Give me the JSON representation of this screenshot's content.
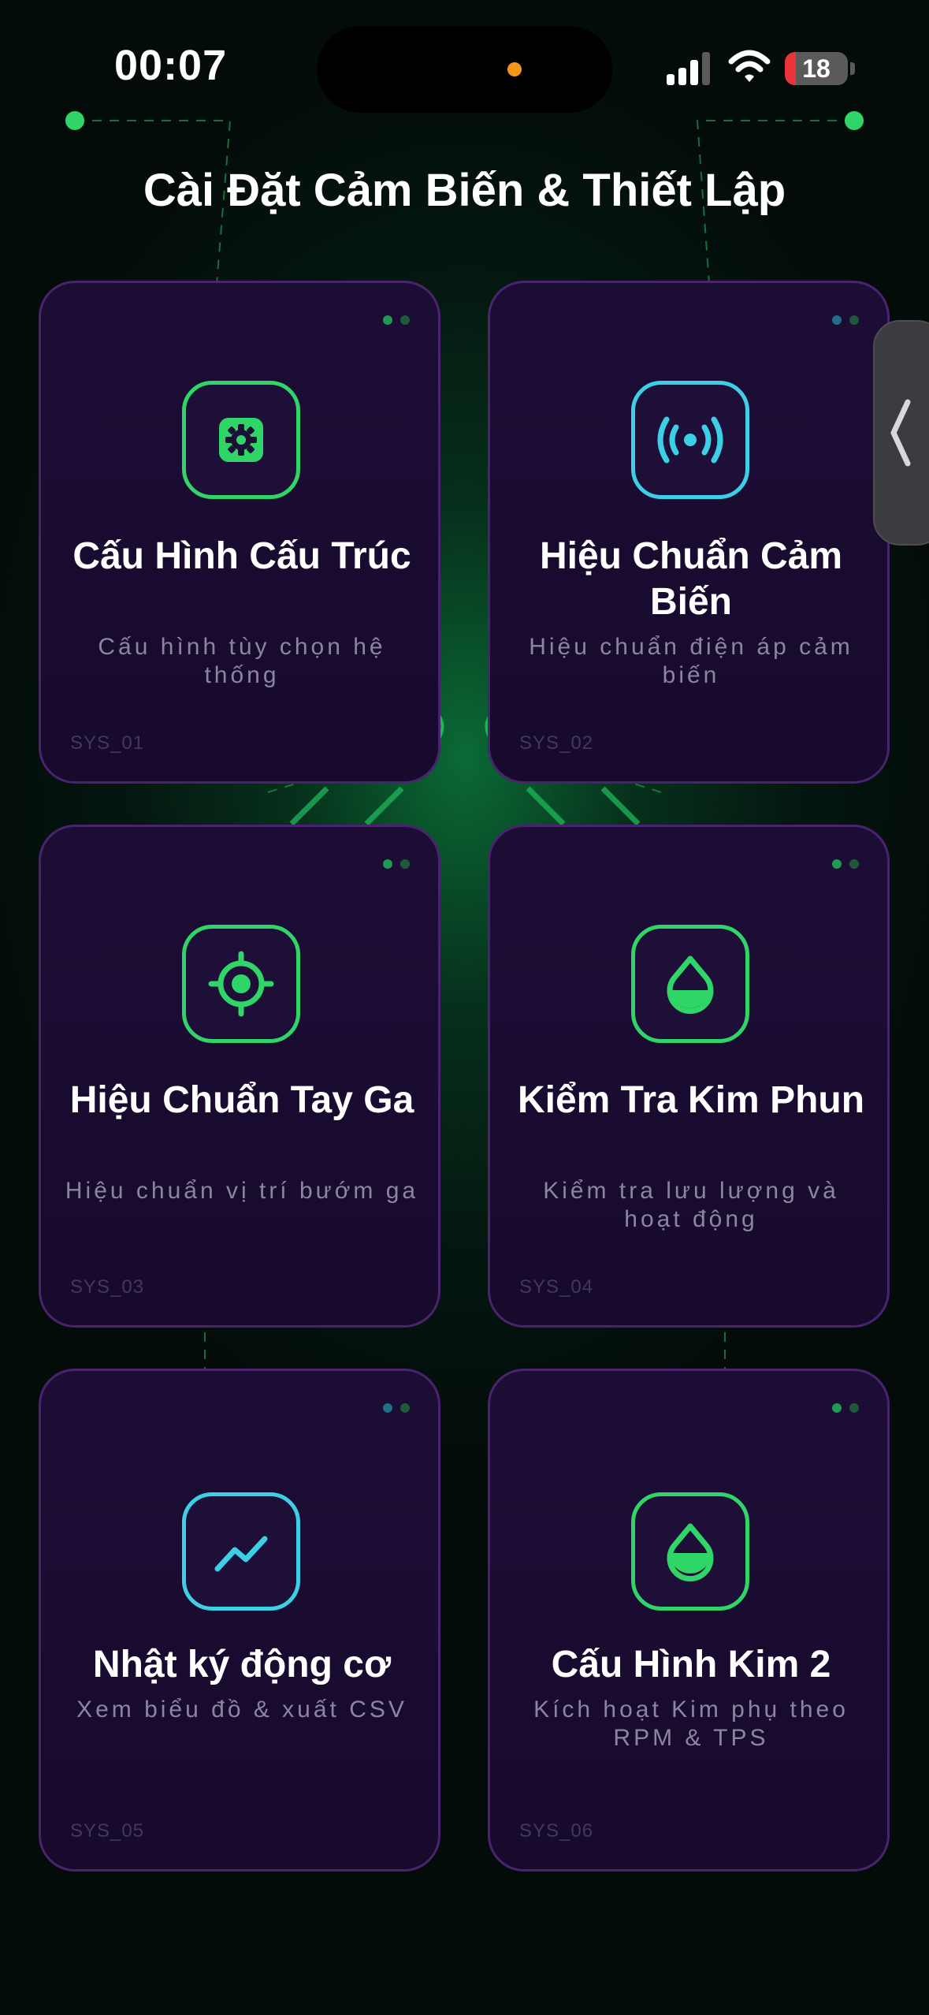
{
  "status_bar": {
    "time": "00:07",
    "battery_level": "18",
    "battery_fraction": 0.18,
    "signal_bars": 3
  },
  "page": {
    "title": "Cài Đặt Cảm Biến & Thiết Lập"
  },
  "colors": {
    "accent_green": "#2fd567",
    "accent_cyan": "#3ccfe6",
    "card_border": "#4a2370",
    "card_bg": "#1c0d35"
  },
  "cards": [
    {
      "title": "Cấu Hình Cấu Trúc",
      "subtitle": "Cấu hình tùy chọn hệ thống",
      "code": "SYS_01",
      "icon": "gear-icon",
      "accent": "#2fd567"
    },
    {
      "title": "Hiệu Chuẩn Cảm Biến",
      "subtitle": "Hiệu chuẩn điện áp cảm biến",
      "code": "SYS_02",
      "icon": "broadcast-icon",
      "accent": "#3ccfe6"
    },
    {
      "title": "Hiệu Chuẩn Tay Ga",
      "subtitle": "Hiệu chuẩn vị trí bướm ga",
      "code": "SYS_03",
      "icon": "crosshair-icon",
      "accent": "#2fd567"
    },
    {
      "title": "Kiểm Tra Kim Phun",
      "subtitle": "Kiểm tra lưu lượng và hoạt động",
      "code": "SYS_04",
      "icon": "droplet-icon",
      "accent": "#2fd567"
    },
    {
      "title": "Nhật ký động cơ",
      "subtitle": "Xem biểu đồ & xuất CSV",
      "code": "SYS_05",
      "icon": "trend-chart-icon",
      "accent": "#3ccfe6"
    },
    {
      "title": "Cấu Hình Kim 2",
      "subtitle": "Kích hoạt Kim phụ theo RPM & TPS",
      "code": "SYS_06",
      "icon": "droplet-half-icon",
      "accent": "#2fd567"
    }
  ]
}
